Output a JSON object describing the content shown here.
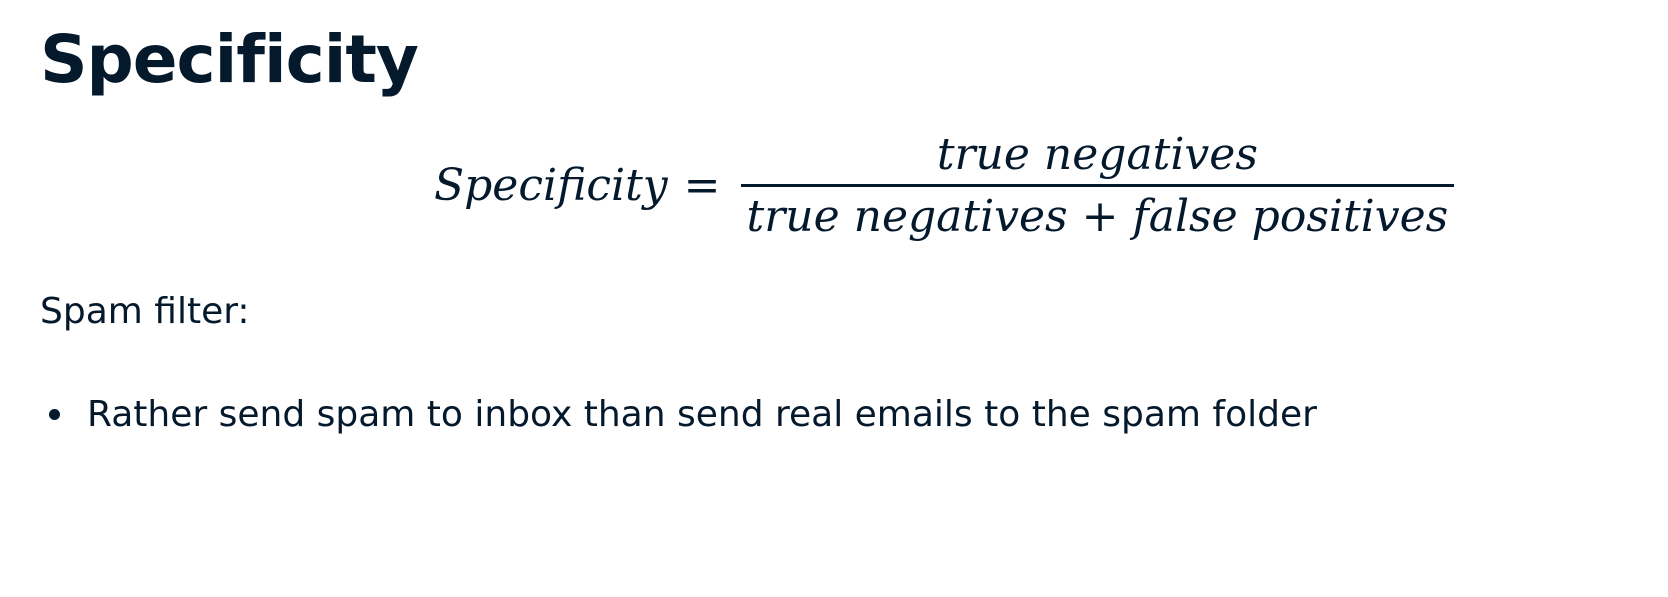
{
  "title": "Specificity",
  "formula": {
    "lhs": "Specificity",
    "equals": "=",
    "numerator": "true negatives",
    "denominator": "true negatives + false positives"
  },
  "section_label": "Spam filter:",
  "bullets": [
    "Rather send spam to inbox than send real emails to the spam folder"
  ],
  "colors": {
    "text": "#05192d",
    "background": "#ffffff"
  }
}
